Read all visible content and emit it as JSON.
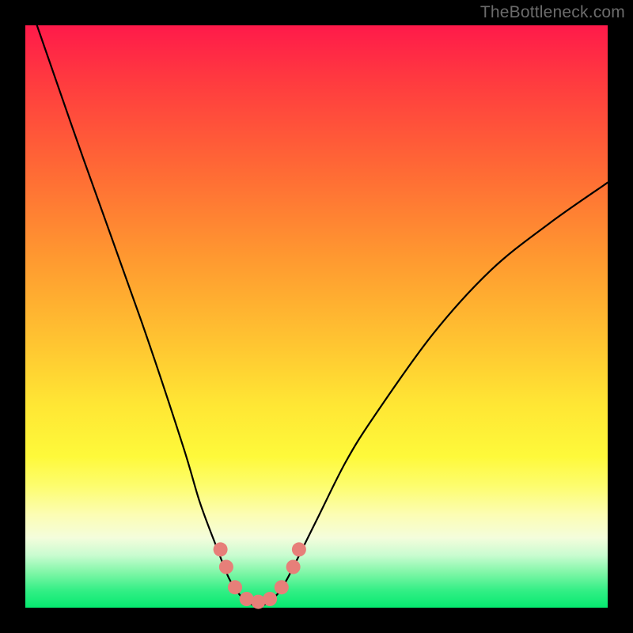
{
  "watermark": "TheBottleneck.com",
  "chart_data": {
    "type": "line",
    "title": "",
    "xlabel": "",
    "ylabel": "",
    "xlim": [
      0,
      100
    ],
    "ylim": [
      0,
      100
    ],
    "series": [
      {
        "name": "bottleneck-curve",
        "x": [
          2,
          10,
          20,
          27,
          30,
          33,
          35,
          37,
          39,
          41,
          43,
          45,
          50,
          55,
          60,
          70,
          80,
          90,
          100
        ],
        "y": [
          100,
          77,
          49,
          28,
          18,
          10,
          5,
          2,
          0.5,
          0.5,
          2,
          5,
          15,
          25,
          33,
          47,
          58,
          66,
          73
        ]
      }
    ],
    "markers": {
      "name": "highlight-dots",
      "points": [
        {
          "x": 33.5,
          "y": 10
        },
        {
          "x": 34.5,
          "y": 7
        },
        {
          "x": 36.0,
          "y": 3.5
        },
        {
          "x": 38.0,
          "y": 1.5
        },
        {
          "x": 40.0,
          "y": 1.0
        },
        {
          "x": 42.0,
          "y": 1.5
        },
        {
          "x": 44.0,
          "y": 3.5
        },
        {
          "x": 46.0,
          "y": 7
        },
        {
          "x": 47.0,
          "y": 10
        }
      ],
      "radius_px": 9,
      "color": "#e77f79"
    },
    "gradient_stops": [
      {
        "pos": 0.0,
        "color": "#ff1a4a"
      },
      {
        "pos": 0.25,
        "color": "#ff6a35"
      },
      {
        "pos": 0.55,
        "color": "#ffc631"
      },
      {
        "pos": 0.74,
        "color": "#fef93a"
      },
      {
        "pos": 0.88,
        "color": "#f4fddc"
      },
      {
        "pos": 1.0,
        "color": "#05e96f"
      }
    ]
  }
}
